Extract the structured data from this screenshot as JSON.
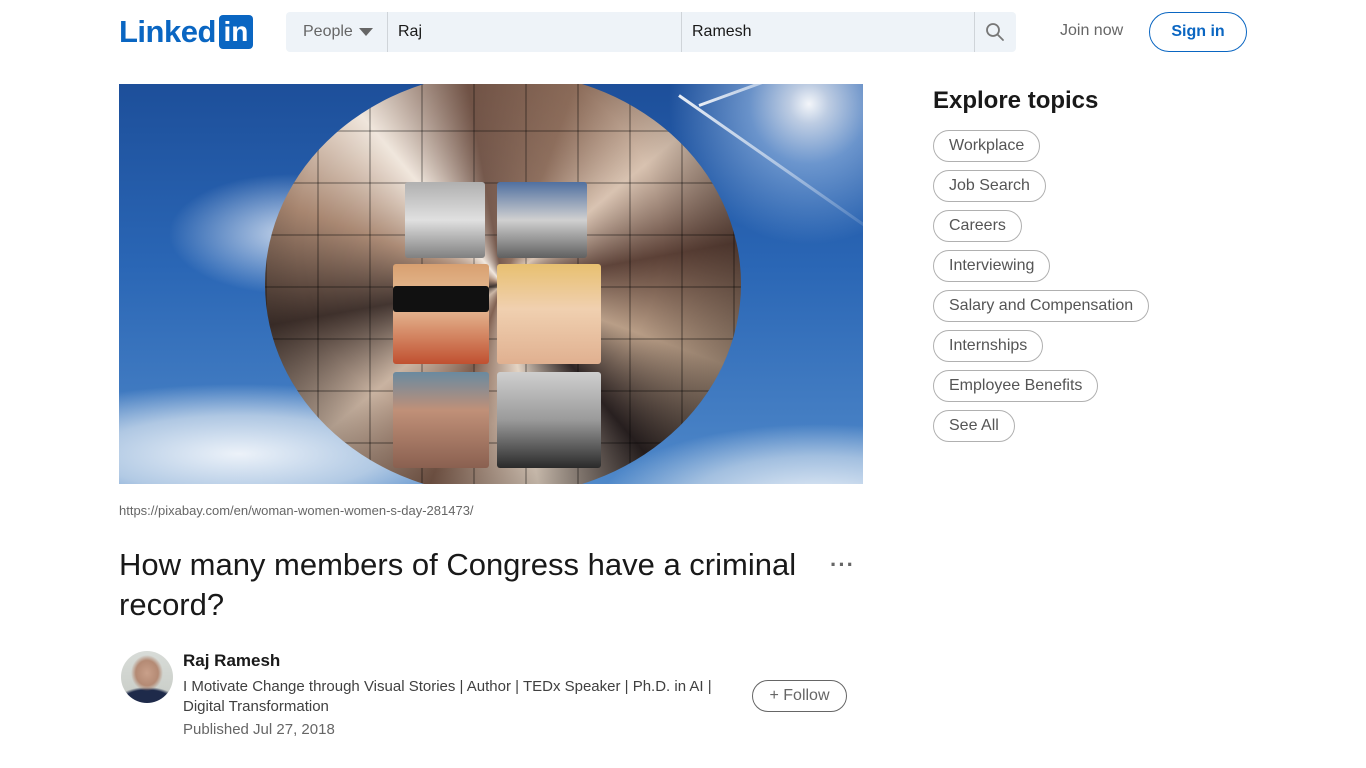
{
  "header": {
    "logo_text": "Linked",
    "logo_box_text": "in",
    "search": {
      "type_label": "People",
      "first_name_value": "Raj",
      "last_name_value": "Ramesh"
    },
    "join_label": "Join now",
    "signin_label": "Sign in"
  },
  "article": {
    "image_source": "https://pixabay.com/en/woman-women-women-s-day-281473/",
    "title": "How many members of Congress have a criminal record?",
    "more_label": "···",
    "author": {
      "name": "Raj Ramesh",
      "headline": "I Motivate Change through Visual Stories | Author | TEDx Speaker | Ph.D. in AI | Digital Transformation",
      "published": "Published Jul 27, 2018"
    },
    "follow_label": "+ Follow"
  },
  "sidebar": {
    "heading": "Explore topics",
    "topics": [
      "Workplace",
      "Job Search",
      "Careers",
      "Interviewing",
      "Salary and Compensation",
      "Internships",
      "Employee Benefits",
      "See All"
    ]
  },
  "colors": {
    "brand": "#0a66c2",
    "search_bg": "#eef3f8",
    "muted_text": "#666666"
  }
}
